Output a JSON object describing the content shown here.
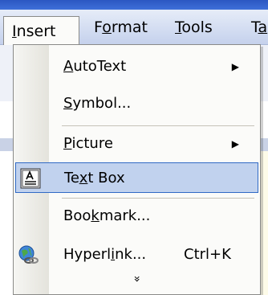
{
  "menubar": {
    "items": [
      {
        "label_pre": "",
        "label_ul": "I",
        "label_post": "nsert"
      },
      {
        "label_pre": "F",
        "label_ul": "o",
        "label_post": "rmat"
      },
      {
        "label_pre": "",
        "label_ul": "T",
        "label_post": "ools"
      },
      {
        "label_pre": "T",
        "label_ul": "a",
        "label_post": "b"
      }
    ]
  },
  "dropdown": {
    "items": [
      {
        "pre": "",
        "ul": "A",
        "post": "utoText",
        "submenu_arrow": "▶"
      },
      {
        "pre": "",
        "ul": "S",
        "post": "ymbol..."
      },
      {
        "pre": "",
        "ul": "P",
        "post": "icture",
        "submenu_arrow": "▶"
      },
      {
        "pre": "Te",
        "ul": "x",
        "post": "t Box",
        "highlighted": true,
        "icon": "text-box-icon"
      },
      {
        "pre": "Boo",
        "ul": "k",
        "post": "mark..."
      },
      {
        "pre": "Hyperl",
        "ul": "i",
        "post": "nk...",
        "shortcut": "Ctrl+K",
        "icon": "hyperlink-globe-icon"
      }
    ],
    "expand_glyph": "»"
  }
}
